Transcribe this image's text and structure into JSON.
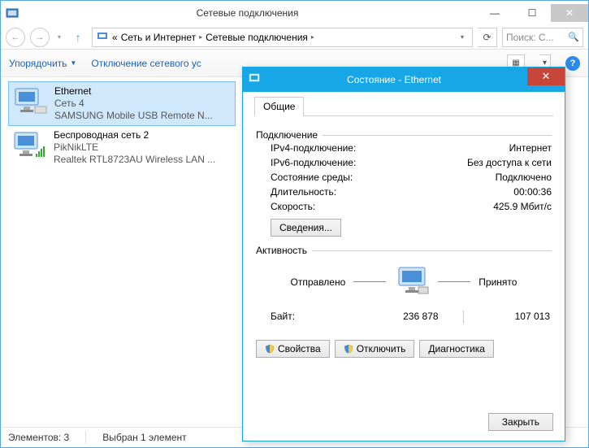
{
  "window": {
    "title": "Сетевые подключения",
    "breadcrumb": {
      "l1": "Сеть и Интернет",
      "l2": "Сетевые подключения",
      "prefix": "«"
    },
    "search_placeholder": "Поиск: С..."
  },
  "toolbar": {
    "organize": "Упорядочить",
    "disable": "Отключение сетевого ус"
  },
  "connections": [
    {
      "name": "Ethernet",
      "network": "Сеть 4",
      "device": "SAMSUNG Mobile USB Remote N..."
    },
    {
      "name": "Беспроводная сеть 2",
      "network": "PikNikLTE",
      "device": "Realtek RTL8723AU Wireless LAN ..."
    }
  ],
  "statusbar": {
    "count": "Элементов: 3",
    "selected": "Выбран 1 элемент"
  },
  "dialog": {
    "title": "Состояние - Ethernet",
    "tab": "Общие",
    "group_connection": "Подключение",
    "rows": {
      "ipv4_k": "IPv4-подключение:",
      "ipv4_v": "Интернет",
      "ipv6_k": "IPv6-подключение:",
      "ipv6_v": "Без доступа к сети",
      "media_k": "Состояние среды:",
      "media_v": "Подключено",
      "dur_k": "Длительность:",
      "dur_v": "00:00:36",
      "speed_k": "Скорость:",
      "speed_v": "425.9 Мбит/с"
    },
    "details_btn": "Сведения...",
    "group_activity": "Активность",
    "sent_label": "Отправлено",
    "recv_label": "Принято",
    "bytes_label": "Байт:",
    "bytes_sent": "236 878",
    "bytes_recv": "107 013",
    "btn_properties": "Свойства",
    "btn_disable": "Отключить",
    "btn_diagnose": "Диагностика",
    "btn_close": "Закрыть"
  }
}
